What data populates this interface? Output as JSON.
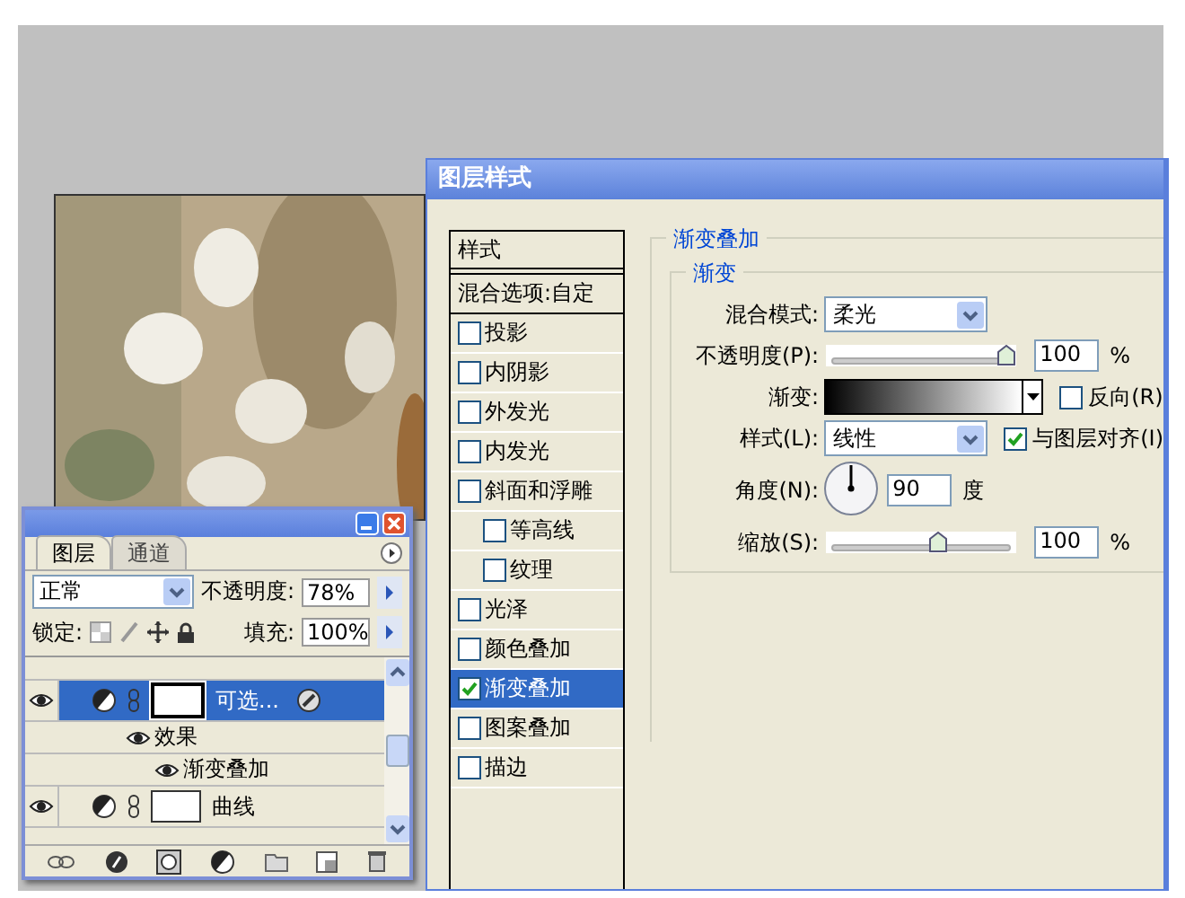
{
  "layers_panel": {
    "tabs": [
      {
        "label": "图层",
        "selected": true
      },
      {
        "label": "通道",
        "selected": false
      }
    ],
    "blend_mode": "正常",
    "opacity_label": "不透明度:",
    "opacity": "78%",
    "lock_label": "锁定:",
    "fill_label": "填充:",
    "fill": "100%",
    "layers": [
      {
        "name": "可选...",
        "visible": true,
        "selected": true,
        "has_effects": true,
        "children": [
          {
            "name": "效果",
            "visible": true,
            "children": [
              {
                "name": "渐变叠加",
                "visible": true
              }
            ]
          }
        ]
      },
      {
        "name": "曲线",
        "visible": true,
        "selected": false,
        "has_effects": false
      }
    ]
  },
  "dialog": {
    "title": "图层样式",
    "styles_header": "样式",
    "blend_options": "混合选项:自定",
    "styles": [
      {
        "label": "投影",
        "checked": false,
        "selected": false
      },
      {
        "label": "内阴影",
        "checked": false,
        "selected": false
      },
      {
        "label": "外发光",
        "checked": false,
        "selected": false
      },
      {
        "label": "内发光",
        "checked": false,
        "selected": false
      },
      {
        "label": "斜面和浮雕",
        "checked": false,
        "selected": false,
        "children": [
          {
            "label": "等高线",
            "checked": false,
            "selected": false
          },
          {
            "label": "纹理",
            "checked": false,
            "selected": false
          }
        ]
      },
      {
        "label": "光泽",
        "checked": false,
        "selected": false
      },
      {
        "label": "颜色叠加",
        "checked": false,
        "selected": false
      },
      {
        "label": "渐变叠加",
        "checked": true,
        "selected": true
      },
      {
        "label": "图案叠加",
        "checked": false,
        "selected": false
      },
      {
        "label": "描边",
        "checked": false,
        "selected": false
      }
    ],
    "section_title": "渐变叠加",
    "group_title": "渐变",
    "fields": [
      {
        "kind": "select",
        "label": "混合模式:",
        "value": "柔光"
      },
      {
        "kind": "slider",
        "label": "不透明度(P):",
        "level": 1,
        "value": "100",
        "unit": "%"
      },
      {
        "kind": "gradient",
        "label": "渐变:",
        "option": {
          "label": "反向(R)",
          "checked": false
        }
      },
      {
        "kind": "select",
        "label": "样式(L):",
        "value": "线性",
        "option": {
          "label": "与图层对齐(I)",
          "checked": true
        }
      },
      {
        "kind": "dial",
        "label": "角度(N):",
        "value": "90",
        "unit": "度"
      },
      {
        "kind": "slider",
        "label": "缩放(S):",
        "level": 0.6,
        "value": "100",
        "unit": "%"
      }
    ]
  }
}
